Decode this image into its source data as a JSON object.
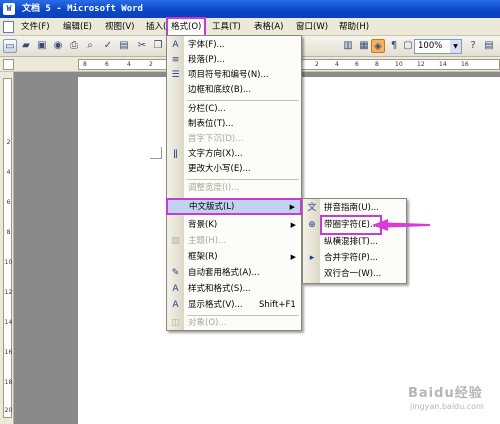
{
  "window": {
    "title": "文档 5 - Microsoft Word"
  },
  "menubar": {
    "items": [
      {
        "label": "文件(F)"
      },
      {
        "label": "编辑(E)"
      },
      {
        "label": "视图(V)"
      },
      {
        "label": "插入(I)"
      },
      {
        "label": "格式(O)"
      },
      {
        "label": "工具(T)"
      },
      {
        "label": "表格(A)"
      },
      {
        "label": "窗口(W)"
      },
      {
        "label": "帮助(H)"
      }
    ]
  },
  "toolbar": {
    "zoom": "100%"
  },
  "ruler": {
    "numbers": [
      "8",
      "6",
      "4",
      "2",
      "2",
      "4",
      "6",
      "8",
      "10",
      "12",
      "14",
      "16"
    ]
  },
  "vruler": {
    "numbers": [
      "2",
      "4",
      "6",
      "8",
      "10",
      "12",
      "14",
      "16",
      "18",
      "20"
    ]
  },
  "format_menu": {
    "items": [
      {
        "label": "字体(F)...",
        "icon": "font-icon",
        "disabled": false
      },
      {
        "label": "段落(P)...",
        "icon": "paragraph-icon",
        "disabled": false
      },
      {
        "label": "项目符号和编号(N)...",
        "icon": "bullets-icon",
        "disabled": false
      },
      {
        "label": "边框和底纹(B)...",
        "icon": "",
        "disabled": false
      },
      {
        "label": "分栏(C)...",
        "icon": "columns-icon",
        "disabled": false
      },
      {
        "label": "制表位(T)...",
        "icon": "",
        "disabled": false
      },
      {
        "label": "首字下沉(D)...",
        "icon": "",
        "disabled": true
      },
      {
        "label": "文字方向(X)...",
        "icon": "text-direction-icon",
        "disabled": false
      },
      {
        "label": "更改大小写(E)...",
        "icon": "",
        "disabled": false
      },
      {
        "label": "调整宽度(I)...",
        "icon": "",
        "disabled": true
      },
      {
        "label": "中文版式(L)",
        "icon": "",
        "disabled": false,
        "submenu": true
      },
      {
        "label": "背景(K)",
        "icon": "",
        "disabled": false,
        "submenu": true
      },
      {
        "label": "主题(H)...",
        "icon": "theme-icon",
        "disabled": true
      },
      {
        "label": "框架(R)",
        "icon": "",
        "disabled": false,
        "submenu": true
      },
      {
        "label": "自动套用格式(A)...",
        "icon": "autoformat-icon",
        "disabled": false
      },
      {
        "label": "样式和格式(S)...",
        "icon": "styles-icon",
        "disabled": false
      },
      {
        "label": "显示格式(V)...",
        "icon": "reveal-format-icon",
        "disabled": false,
        "shortcut": "Shift+F1"
      },
      {
        "label": "对象(O)...",
        "icon": "object-icon",
        "disabled": true
      }
    ]
  },
  "chinese_layout_submenu": {
    "items": [
      {
        "label": "拼音指南(U)...",
        "icon": "phonetic-guide-icon"
      },
      {
        "label": "带圈字符(E)...",
        "icon": "enclosed-char-icon"
      },
      {
        "label": "纵横混排(T)...",
        "icon": ""
      },
      {
        "label": "合并字符(P)...",
        "icon": "combine-chars-icon"
      },
      {
        "label": "双行合一(W)...",
        "icon": ""
      }
    ]
  },
  "colors": {
    "titlebar": "#0a48c9",
    "highlight": "#c1d2ee",
    "annotation": "#c43bd9"
  },
  "watermark": {
    "line1": "Baidu经验",
    "line2": "jingyan.baidu.com"
  }
}
